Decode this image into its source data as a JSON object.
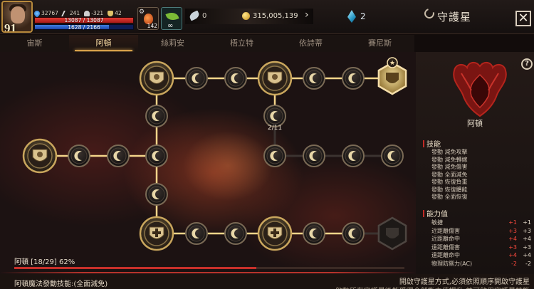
{
  "player": {
    "level": "91",
    "stats": [
      {
        "icon": "blue-flame-icon",
        "value": "32767"
      },
      {
        "icon": "crossed-swords-icon",
        "value": "241"
      },
      {
        "icon": "helmet-icon",
        "value": "-321"
      },
      {
        "icon": "trophy-icon",
        "value": "42"
      }
    ],
    "hp_text": "13087 / 13087",
    "hp_ratio": 1.0,
    "mp_text": "1628 / 2166",
    "mp_ratio": 0.75
  },
  "items": {
    "potion_count": "142",
    "herb_label": "∞"
  },
  "currency": {
    "feather": "0",
    "gold": "315,005,139",
    "gems": "2"
  },
  "header": {
    "title": "守護星",
    "close_label": "✕"
  },
  "tabs": [
    {
      "label": "宙斯",
      "active": false
    },
    {
      "label": "阿頓",
      "active": true
    },
    {
      "label": "絲莉安",
      "active": false
    },
    {
      "label": "梧立特",
      "active": false
    },
    {
      "label": "依詩蒂",
      "active": false
    },
    {
      "label": "賽尼斯",
      "active": false
    }
  ],
  "board": {
    "node_counter": "2/11",
    "progress_label": "阿頓 [18/29] 62%",
    "progress_ratio": 0.62
  },
  "panel": {
    "hero_name": "阿頓",
    "help_label": "?",
    "skills_title": "技能",
    "skills": [
      "發動 減免攻擊",
      "發動 減免轉嫁",
      "發動 減免傷害",
      "發動 全面減免",
      "發動 恢復負重",
      "發動 恢復體能",
      "發動 全面恢復"
    ],
    "ability_title": "能力值",
    "abilities": [
      {
        "name": "敏捷",
        "delta": "+1",
        "value": "+1"
      },
      {
        "name": "近距離傷害",
        "delta": "+3",
        "value": "+3"
      },
      {
        "name": "近距離命中",
        "delta": "+4",
        "value": "+4"
      },
      {
        "name": "遠距離傷害",
        "delta": "+3",
        "value": "+3"
      },
      {
        "name": "遠距離命中",
        "delta": "+4",
        "value": "+4"
      },
      {
        "name": "物理防禦力(AC)",
        "delta": "-2",
        "value": "-2"
      }
    ]
  },
  "footer": {
    "skill_trigger": "阿頓魔法發動技能:(全面減免)",
    "hint_line1": "開啟守護星方式,必須依照順序開啟守護星",
    "hint_line2": "啟動所有守護星後能獲得全部能力值提升,並可啟用守護星技能"
  },
  "colors": {
    "accent_gold": "#d6a04a",
    "accent_red": "#c7302a",
    "hp": "#d13029",
    "mp": "#2f66cc"
  }
}
